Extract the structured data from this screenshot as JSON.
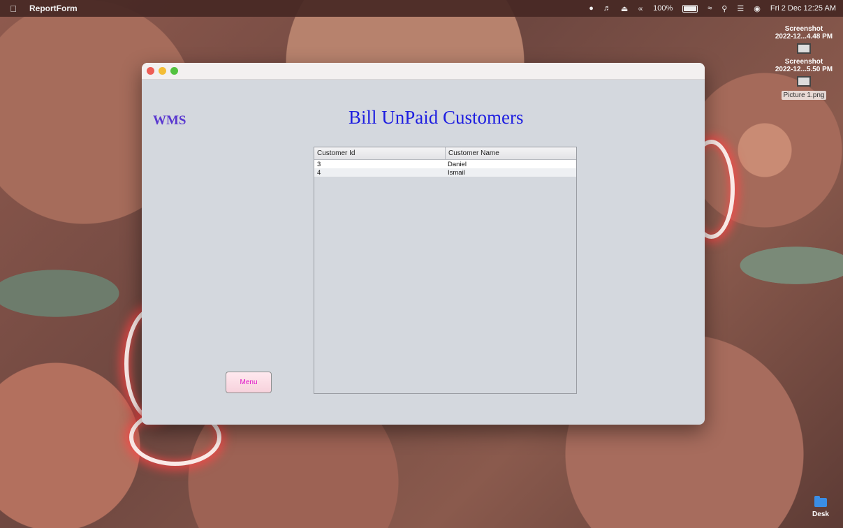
{
  "menubar": {
    "app_name": "ReportForm",
    "battery": "100%",
    "datetime": "Fri 2 Dec  12:25 AM"
  },
  "desktop": {
    "items": [
      {
        "label": "Screenshot\n2022-12...4.48 PM"
      },
      {
        "label": "Screenshot\n2022-12...5.50 PM"
      },
      {
        "label": "Picture 1.png"
      }
    ],
    "folder_label": "Desk"
  },
  "window": {
    "logo": "WMS",
    "title": "Bill UnPaid Customers",
    "menu_button": "Menu",
    "table": {
      "columns": [
        "Customer Id",
        "Customer Name"
      ],
      "rows": [
        {
          "id": "3",
          "name": "Daniel"
        },
        {
          "id": "4",
          "name": "Ismail"
        }
      ]
    }
  }
}
